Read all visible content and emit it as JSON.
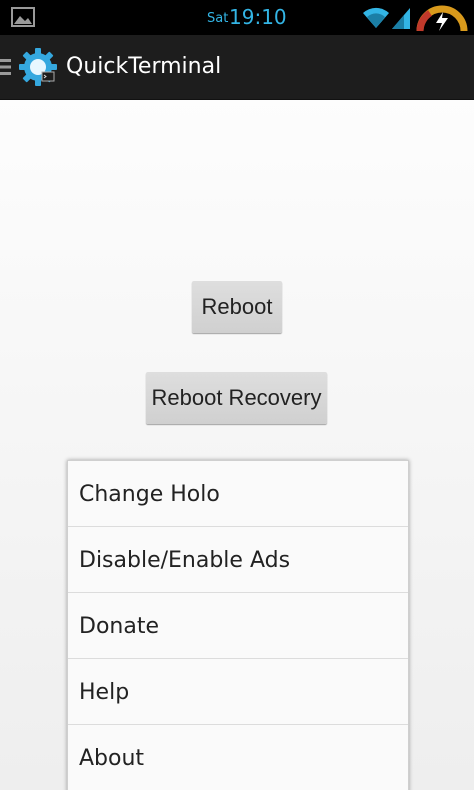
{
  "status_bar": {
    "day": "Sat",
    "time": "19:10",
    "accent": "#33b5e5"
  },
  "action_bar": {
    "title": "QuickTerminal"
  },
  "main": {
    "reboot_label": "Reboot",
    "reboot_recovery_label": "Reboot Recovery"
  },
  "overflow_menu": {
    "items": [
      {
        "label": "Change Holo"
      },
      {
        "label": "Disable/Enable Ads"
      },
      {
        "label": "Donate"
      },
      {
        "label": "Help"
      },
      {
        "label": "About"
      }
    ]
  }
}
